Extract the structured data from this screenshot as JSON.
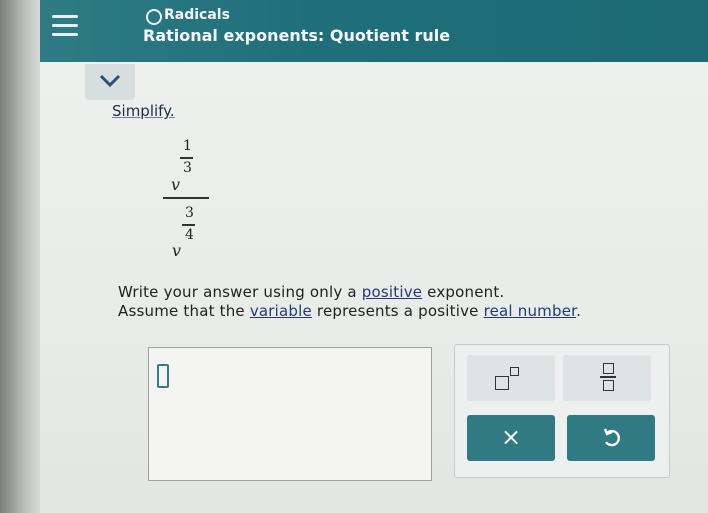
{
  "header": {
    "topic": "Radicals",
    "lesson_title": "Rational exponents: Quotient rule"
  },
  "problem": {
    "instruction": "Simplify.",
    "numerator": {
      "base": "v",
      "exp_num": "1",
      "exp_den": "3"
    },
    "denominator": {
      "base": "v",
      "exp_num": "3",
      "exp_den": "4"
    },
    "line1_prefix": "Write your answer using only a ",
    "line1_link": "positive",
    "line1_suffix": " exponent.",
    "line2_prefix": "Assume that the ",
    "line2_link1": "variable",
    "line2_mid": " represents a positive ",
    "line2_link2": "real number",
    "line2_suffix": "."
  },
  "toolbox": {
    "clear_label": "×"
  },
  "icons": {
    "menu": "hamburger-icon",
    "radio": "radio-circle-icon",
    "collapse": "chevron-down-icon",
    "exponent": "exponent-template-icon",
    "fraction": "fraction-template-icon",
    "undo": "undo-icon"
  },
  "colors": {
    "header": "#1f6f7b",
    "accent_button": "#2f7a83"
  }
}
